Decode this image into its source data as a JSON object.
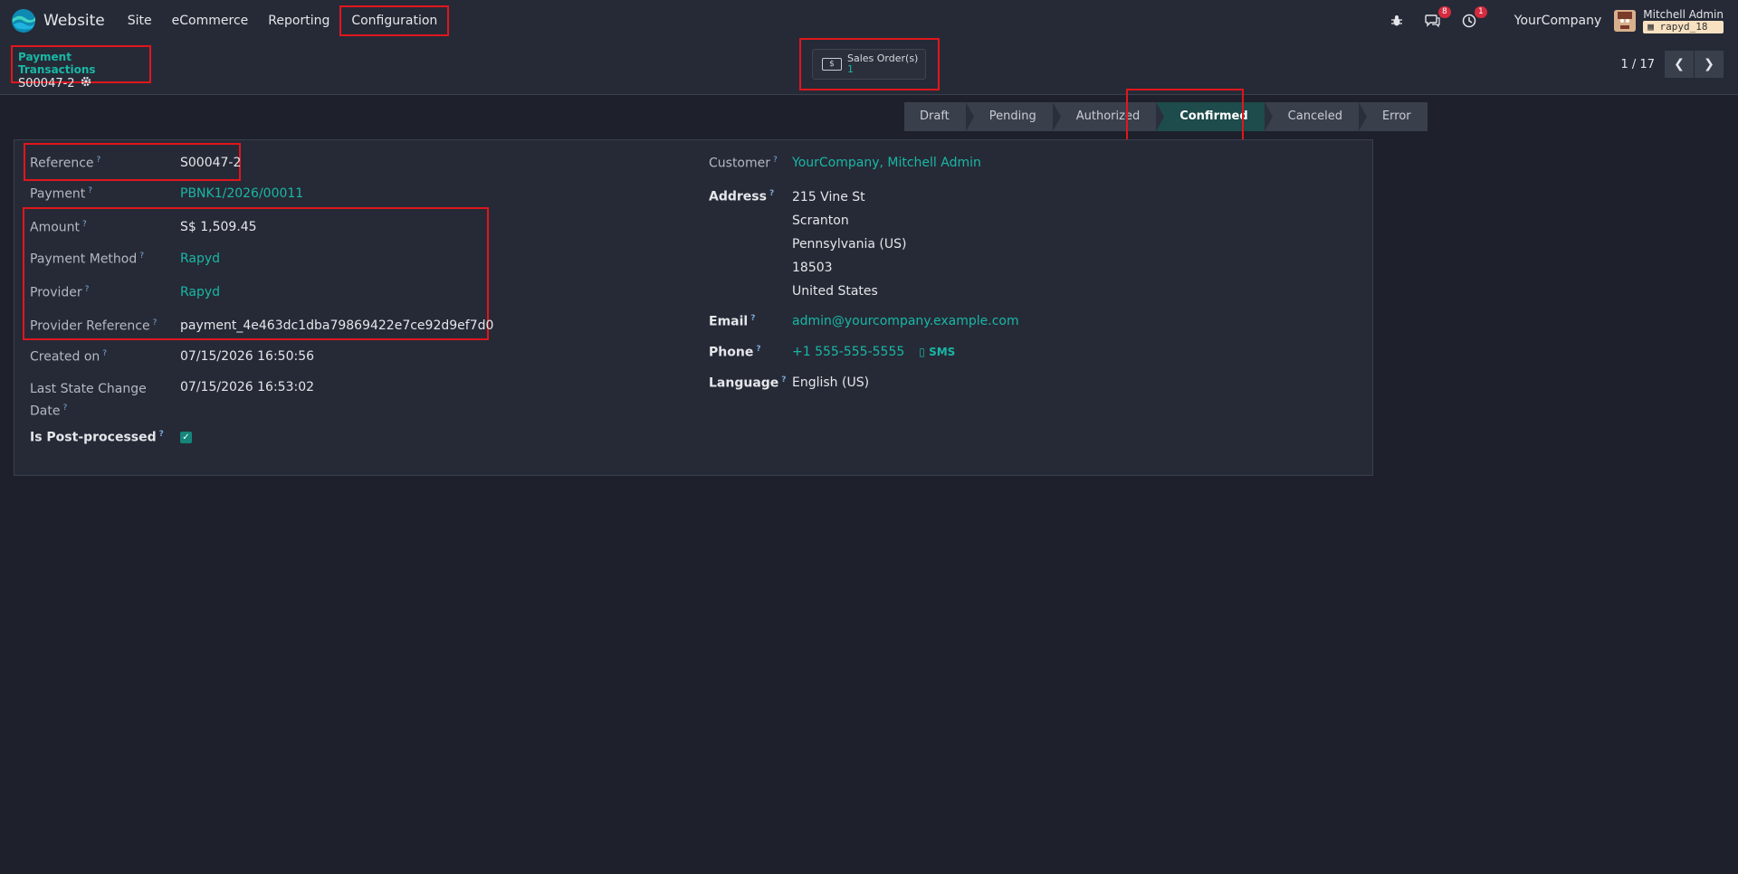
{
  "app": {
    "name": "Website"
  },
  "menu": [
    "Site",
    "eCommerce",
    "Reporting",
    "Configuration"
  ],
  "systray": {
    "messages_badge": "8",
    "activities_badge": "1",
    "company": "YourCompany",
    "user_name": "Mitchell Admin",
    "db_name": "rapyd_18"
  },
  "breadcrumb": {
    "parent": "Payment Transactions",
    "current": "S00047-2"
  },
  "smart_button": {
    "label": "Sales Order(s)",
    "value": "1"
  },
  "pager": {
    "value": "1 / 17"
  },
  "statusbar": {
    "stages": [
      "Draft",
      "Pending",
      "Authorized",
      "Confirmed",
      "Canceled",
      "Error"
    ],
    "active": "Confirmed"
  },
  "form": {
    "reference": {
      "label": "Reference",
      "value": "S00047-2"
    },
    "payment": {
      "label": "Payment",
      "value": "PBNK1/2026/00011"
    },
    "amount": {
      "label": "Amount",
      "value": "S$ 1,509.45"
    },
    "payment_method": {
      "label": "Payment Method",
      "value": "Rapyd"
    },
    "provider": {
      "label": "Provider",
      "value": "Rapyd"
    },
    "provider_reference": {
      "label": "Provider Reference",
      "value": "payment_4e463dc1dba79869422e7ce92d9ef7d0"
    },
    "created_on": {
      "label": "Created on",
      "value": "07/15/2026 16:50:56"
    },
    "last_state_change": {
      "label_line1": "Last State Change",
      "label_line2": "Date",
      "value": "07/15/2026 16:53:02"
    },
    "is_post_processed": {
      "label": "Is Post-processed",
      "value": true
    },
    "customer": {
      "label": "Customer",
      "value": "YourCompany, Mitchell Admin"
    },
    "address": {
      "label": "Address",
      "lines": [
        "215 Vine St",
        "Scranton",
        "Pennsylvania (US)",
        "18503",
        "United States"
      ]
    },
    "email": {
      "label": "Email",
      "value": "admin@yourcompany.example.com"
    },
    "phone": {
      "label": "Phone",
      "value": "+1 555-555-5555",
      "sms": "SMS"
    },
    "language": {
      "label": "Language",
      "value": "English (US)"
    }
  },
  "tooltip_mark": "?"
}
